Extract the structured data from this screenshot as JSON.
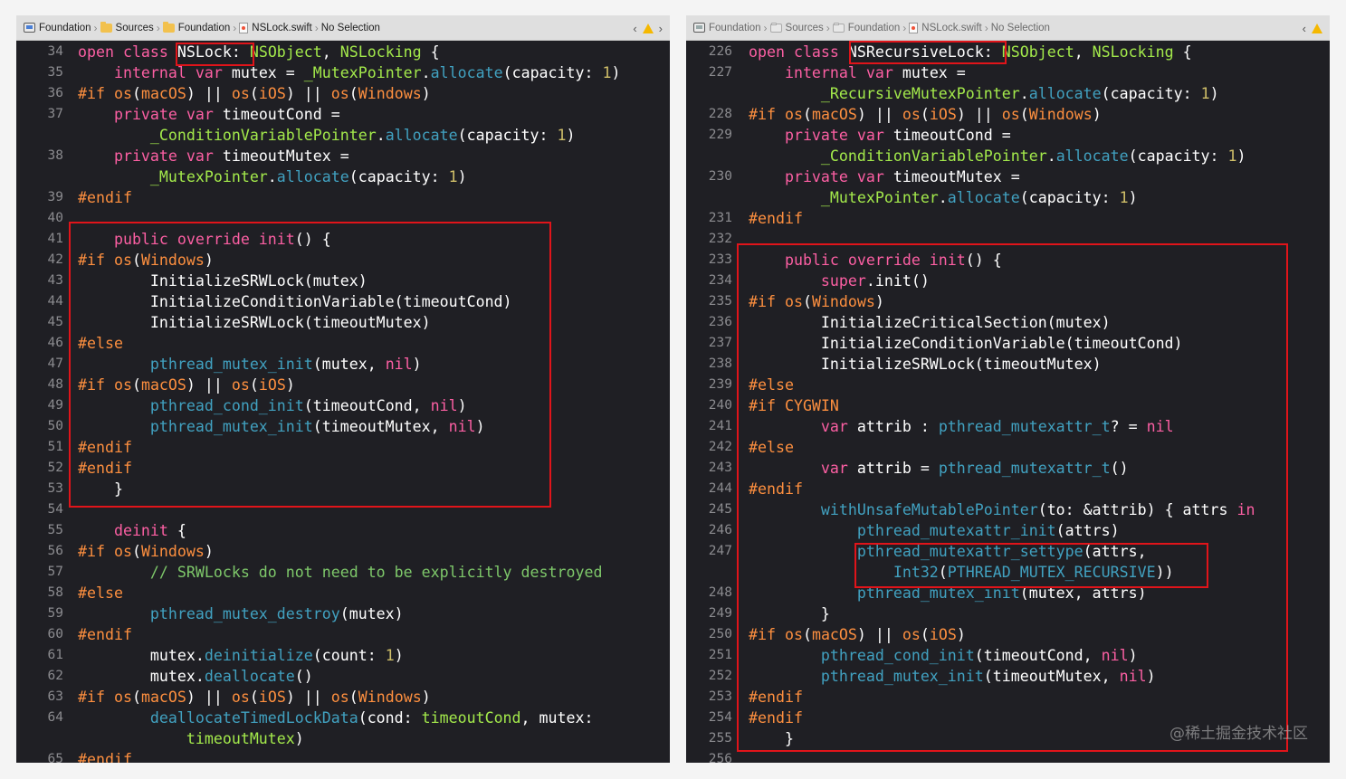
{
  "left_pane": {
    "breadcrumb": [
      "Foundation",
      "Sources",
      "Foundation",
      "NSLock.swift",
      "No Selection"
    ],
    "lines": [
      {
        "n": "34",
        "t": [
          [
            "kw",
            "open class "
          ],
          [
            "pl",
            "NSLock:"
          ],
          [
            "ty",
            " NSObject"
          ],
          [
            "pl",
            ", "
          ],
          [
            "ty",
            "NSLocking"
          ],
          [
            "pl",
            " {"
          ]
        ]
      },
      {
        "n": "35",
        "t": [
          [
            "kw",
            "    internal var "
          ],
          [
            "pl",
            "mutex = "
          ],
          [
            "ty",
            "_MutexPointer"
          ],
          [
            "pl",
            "."
          ],
          [
            "fn",
            "allocate"
          ],
          [
            "pl",
            "(capacity: "
          ],
          [
            "num",
            "1"
          ],
          [
            "pl",
            ")"
          ]
        ]
      },
      {
        "n": "36",
        "t": [
          [
            "pp",
            "#if "
          ],
          [
            "pp",
            "os"
          ],
          [
            "pl",
            "("
          ],
          [
            "pp",
            "macOS"
          ],
          [
            "pl",
            ") || "
          ],
          [
            "pp",
            "os"
          ],
          [
            "pl",
            "("
          ],
          [
            "pp",
            "iOS"
          ],
          [
            "pl",
            ") || "
          ],
          [
            "pp",
            "os"
          ],
          [
            "pl",
            "("
          ],
          [
            "pp",
            "Windows"
          ],
          [
            "pl",
            ")"
          ]
        ]
      },
      {
        "n": "37",
        "t": [
          [
            "kw",
            "    private var "
          ],
          [
            "pl",
            "timeoutCond ="
          ]
        ]
      },
      {
        "n": "",
        "t": [
          [
            "ty",
            "        _ConditionVariablePointer"
          ],
          [
            "pl",
            "."
          ],
          [
            "fn",
            "allocate"
          ],
          [
            "pl",
            "(capacity: "
          ],
          [
            "num",
            "1"
          ],
          [
            "pl",
            ")"
          ]
        ]
      },
      {
        "n": "38",
        "t": [
          [
            "kw",
            "    private var "
          ],
          [
            "pl",
            "timeoutMutex ="
          ]
        ]
      },
      {
        "n": "",
        "t": [
          [
            "ty",
            "        _MutexPointer"
          ],
          [
            "pl",
            "."
          ],
          [
            "fn",
            "allocate"
          ],
          [
            "pl",
            "(capacity: "
          ],
          [
            "num",
            "1"
          ],
          [
            "pl",
            ")"
          ]
        ]
      },
      {
        "n": "39",
        "t": [
          [
            "pp",
            "#endif"
          ]
        ]
      },
      {
        "n": "40",
        "t": []
      },
      {
        "n": "41",
        "t": [
          [
            "kw",
            "    public override init"
          ],
          [
            "pl",
            "() {"
          ]
        ]
      },
      {
        "n": "42",
        "t": [
          [
            "pp",
            "#if "
          ],
          [
            "pp",
            "os"
          ],
          [
            "pl",
            "("
          ],
          [
            "pp",
            "Windows"
          ],
          [
            "pl",
            ")"
          ]
        ]
      },
      {
        "n": "43",
        "t": [
          [
            "pl",
            "        InitializeSRWLock(mutex)"
          ]
        ]
      },
      {
        "n": "44",
        "t": [
          [
            "pl",
            "        InitializeConditionVariable(timeoutCond)"
          ]
        ]
      },
      {
        "n": "45",
        "t": [
          [
            "pl",
            "        InitializeSRWLock(timeoutMutex)"
          ]
        ]
      },
      {
        "n": "46",
        "t": [
          [
            "pp",
            "#else"
          ]
        ]
      },
      {
        "n": "47",
        "t": [
          [
            "fn",
            "        pthread_mutex_init"
          ],
          [
            "pl",
            "("
          ],
          [
            "pl",
            "mutex, "
          ],
          [
            "kw",
            "nil"
          ],
          [
            "pl",
            ")"
          ]
        ]
      },
      {
        "n": "48",
        "t": [
          [
            "pp",
            "#if "
          ],
          [
            "pp",
            "os"
          ],
          [
            "pl",
            "("
          ],
          [
            "pp",
            "macOS"
          ],
          [
            "pl",
            ") || "
          ],
          [
            "pp",
            "os"
          ],
          [
            "pl",
            "("
          ],
          [
            "pp",
            "iOS"
          ],
          [
            "pl",
            ")"
          ]
        ]
      },
      {
        "n": "49",
        "t": [
          [
            "fn",
            "        pthread_cond_init"
          ],
          [
            "pl",
            "("
          ],
          [
            "pl",
            "timeoutCond, "
          ],
          [
            "kw",
            "nil"
          ],
          [
            "pl",
            ")"
          ]
        ]
      },
      {
        "n": "50",
        "t": [
          [
            "fn",
            "        pthread_mutex_init"
          ],
          [
            "pl",
            "("
          ],
          [
            "pl",
            "timeoutMutex, "
          ],
          [
            "kw",
            "nil"
          ],
          [
            "pl",
            ")"
          ]
        ]
      },
      {
        "n": "51",
        "t": [
          [
            "pp",
            "#endif"
          ]
        ]
      },
      {
        "n": "52",
        "t": [
          [
            "pp",
            "#endif"
          ]
        ]
      },
      {
        "n": "53",
        "t": [
          [
            "pl",
            "    }"
          ]
        ]
      },
      {
        "n": "54",
        "t": []
      },
      {
        "n": "55",
        "t": [
          [
            "kw",
            "    deinit"
          ],
          [
            "pl",
            " {"
          ]
        ]
      },
      {
        "n": "56",
        "t": [
          [
            "pp",
            "#if "
          ],
          [
            "pp",
            "os"
          ],
          [
            "pl",
            "("
          ],
          [
            "pp",
            "Windows"
          ],
          [
            "pl",
            ")"
          ]
        ]
      },
      {
        "n": "57",
        "t": [
          [
            "cm",
            "        // SRWLocks do not need to be explicitly destroyed"
          ]
        ]
      },
      {
        "n": "58",
        "t": [
          [
            "pp",
            "#else"
          ]
        ]
      },
      {
        "n": "59",
        "t": [
          [
            "fn",
            "        pthread_mutex_destroy"
          ],
          [
            "pl",
            "(mutex)"
          ]
        ]
      },
      {
        "n": "60",
        "t": [
          [
            "pp",
            "#endif"
          ]
        ]
      },
      {
        "n": "61",
        "t": [
          [
            "pl",
            "        mutex."
          ],
          [
            "fn",
            "deinitialize"
          ],
          [
            "pl",
            "(count: "
          ],
          [
            "num",
            "1"
          ],
          [
            "pl",
            ")"
          ]
        ]
      },
      {
        "n": "62",
        "t": [
          [
            "pl",
            "        mutex."
          ],
          [
            "fn",
            "deallocate"
          ],
          [
            "pl",
            "()"
          ]
        ]
      },
      {
        "n": "63",
        "t": [
          [
            "pp",
            "#if "
          ],
          [
            "pp",
            "os"
          ],
          [
            "pl",
            "("
          ],
          [
            "pp",
            "macOS"
          ],
          [
            "pl",
            ") || "
          ],
          [
            "pp",
            "os"
          ],
          [
            "pl",
            "("
          ],
          [
            "pp",
            "iOS"
          ],
          [
            "pl",
            ") || "
          ],
          [
            "pp",
            "os"
          ],
          [
            "pl",
            "("
          ],
          [
            "pp",
            "Windows"
          ],
          [
            "pl",
            ")"
          ]
        ]
      },
      {
        "n": "64",
        "t": [
          [
            "fn",
            "        deallocateTimedLockData"
          ],
          [
            "pl",
            "(cond: "
          ],
          [
            "ty",
            "timeoutCond"
          ],
          [
            "pl",
            ", mutex:"
          ]
        ]
      },
      {
        "n": "",
        "t": [
          [
            "ty",
            "            timeoutMutex"
          ],
          [
            "pl",
            ")"
          ]
        ]
      },
      {
        "n": "65",
        "t": [
          [
            "pp",
            "#endif"
          ]
        ]
      }
    ]
  },
  "right_pane": {
    "breadcrumb": [
      "Foundation",
      "Sources",
      "Foundation",
      "NSLock.swift",
      "No Selection"
    ],
    "lines": [
      {
        "n": "226",
        "t": [
          [
            "kw",
            "open class "
          ],
          [
            "pl",
            "NSRecursiveLock:"
          ],
          [
            "ty",
            " NSObject"
          ],
          [
            "pl",
            ", "
          ],
          [
            "ty",
            "NSLocking"
          ],
          [
            "pl",
            " {"
          ]
        ]
      },
      {
        "n": "227",
        "t": [
          [
            "kw",
            "    internal var "
          ],
          [
            "pl",
            "mutex ="
          ]
        ]
      },
      {
        "n": "",
        "t": [
          [
            "ty",
            "        _RecursiveMutexPointer"
          ],
          [
            "pl",
            "."
          ],
          [
            "fn",
            "allocate"
          ],
          [
            "pl",
            "(capacity: "
          ],
          [
            "num",
            "1"
          ],
          [
            "pl",
            ")"
          ]
        ]
      },
      {
        "n": "228",
        "t": [
          [
            "pp",
            "#if "
          ],
          [
            "pp",
            "os"
          ],
          [
            "pl",
            "("
          ],
          [
            "pp",
            "macOS"
          ],
          [
            "pl",
            ") || "
          ],
          [
            "pp",
            "os"
          ],
          [
            "pl",
            "("
          ],
          [
            "pp",
            "iOS"
          ],
          [
            "pl",
            ") || "
          ],
          [
            "pp",
            "os"
          ],
          [
            "pl",
            "("
          ],
          [
            "pp",
            "Windows"
          ],
          [
            "pl",
            ")"
          ]
        ]
      },
      {
        "n": "229",
        "t": [
          [
            "kw",
            "    private var "
          ],
          [
            "pl",
            "timeoutCond ="
          ]
        ]
      },
      {
        "n": "",
        "t": [
          [
            "ty",
            "        _ConditionVariablePointer"
          ],
          [
            "pl",
            "."
          ],
          [
            "fn",
            "allocate"
          ],
          [
            "pl",
            "(capacity: "
          ],
          [
            "num",
            "1"
          ],
          [
            "pl",
            ")"
          ]
        ]
      },
      {
        "n": "230",
        "t": [
          [
            "kw",
            "    private var "
          ],
          [
            "pl",
            "timeoutMutex ="
          ]
        ]
      },
      {
        "n": "",
        "t": [
          [
            "ty",
            "        _MutexPointer"
          ],
          [
            "pl",
            "."
          ],
          [
            "fn",
            "allocate"
          ],
          [
            "pl",
            "(capacity: "
          ],
          [
            "num",
            "1"
          ],
          [
            "pl",
            ")"
          ]
        ]
      },
      {
        "n": "231",
        "t": [
          [
            "pp",
            "#endif"
          ]
        ]
      },
      {
        "n": "232",
        "t": []
      },
      {
        "n": "233",
        "t": [
          [
            "kw",
            "    public override init"
          ],
          [
            "pl",
            "() {"
          ]
        ]
      },
      {
        "n": "234",
        "t": [
          [
            "kw",
            "        super"
          ],
          [
            "pl",
            "."
          ],
          [
            "pl",
            "init()"
          ]
        ]
      },
      {
        "n": "235",
        "t": [
          [
            "pp",
            "#if "
          ],
          [
            "pp",
            "os"
          ],
          [
            "pl",
            "("
          ],
          [
            "pp",
            "Windows"
          ],
          [
            "pl",
            ")"
          ]
        ]
      },
      {
        "n": "236",
        "t": [
          [
            "pl",
            "        InitializeCriticalSection(mutex)"
          ]
        ]
      },
      {
        "n": "237",
        "t": [
          [
            "pl",
            "        InitializeConditionVariable(timeoutCond)"
          ]
        ]
      },
      {
        "n": "238",
        "t": [
          [
            "pl",
            "        InitializeSRWLock(timeoutMutex)"
          ]
        ]
      },
      {
        "n": "239",
        "t": [
          [
            "pp",
            "#else"
          ]
        ]
      },
      {
        "n": "240",
        "t": [
          [
            "pp",
            "#if CYGWIN"
          ]
        ]
      },
      {
        "n": "241",
        "t": [
          [
            "kw",
            "        var "
          ],
          [
            "pl",
            "attrib : "
          ],
          [
            "fn",
            "pthread_mutexattr_t"
          ],
          [
            "pl",
            "? = "
          ],
          [
            "kw",
            "nil"
          ]
        ]
      },
      {
        "n": "242",
        "t": [
          [
            "pp",
            "#else"
          ]
        ]
      },
      {
        "n": "243",
        "t": [
          [
            "kw",
            "        var "
          ],
          [
            "pl",
            "attrib = "
          ],
          [
            "fn",
            "pthread_mutexattr_t"
          ],
          [
            "pl",
            "()"
          ]
        ]
      },
      {
        "n": "244",
        "t": [
          [
            "pp",
            "#endif"
          ]
        ]
      },
      {
        "n": "245",
        "t": [
          [
            "fn",
            "        withUnsafeMutablePointer"
          ],
          [
            "pl",
            "(to: &attrib) { attrs "
          ],
          [
            "kw",
            "in"
          ]
        ]
      },
      {
        "n": "246",
        "t": [
          [
            "fn",
            "            pthread_mutexattr_init"
          ],
          [
            "pl",
            "(attrs)"
          ]
        ]
      },
      {
        "n": "247",
        "t": [
          [
            "fn",
            "            pthread_mutexattr_settype"
          ],
          [
            "pl",
            "(attrs,"
          ]
        ]
      },
      {
        "n": "",
        "t": [
          [
            "fn",
            "                Int32"
          ],
          [
            "pl",
            "("
          ],
          [
            "fn",
            "PTHREAD_MUTEX_RECURSIVE"
          ],
          [
            "pl",
            "))"
          ]
        ]
      },
      {
        "n": "248",
        "t": [
          [
            "fn",
            "            pthread_mutex_init"
          ],
          [
            "pl",
            "(mutex, attrs)"
          ]
        ]
      },
      {
        "n": "249",
        "t": [
          [
            "pl",
            "        }"
          ]
        ]
      },
      {
        "n": "250",
        "t": [
          [
            "pp",
            "#if "
          ],
          [
            "pp",
            "os"
          ],
          [
            "pl",
            "("
          ],
          [
            "pp",
            "macOS"
          ],
          [
            "pl",
            ") || "
          ],
          [
            "pp",
            "os"
          ],
          [
            "pl",
            "("
          ],
          [
            "pp",
            "iOS"
          ],
          [
            "pl",
            ")"
          ]
        ]
      },
      {
        "n": "251",
        "t": [
          [
            "fn",
            "        pthread_cond_init"
          ],
          [
            "pl",
            "(timeoutCond, "
          ],
          [
            "kw",
            "nil"
          ],
          [
            "pl",
            ")"
          ]
        ]
      },
      {
        "n": "252",
        "t": [
          [
            "fn",
            "        pthread_mutex_init"
          ],
          [
            "pl",
            "(timeoutMutex, "
          ],
          [
            "kw",
            "nil"
          ],
          [
            "pl",
            ")"
          ]
        ]
      },
      {
        "n": "253",
        "t": [
          [
            "pp",
            "#endif"
          ]
        ]
      },
      {
        "n": "254",
        "t": [
          [
            "pp",
            "#endif"
          ]
        ]
      },
      {
        "n": "255",
        "t": [
          [
            "pl",
            "    }"
          ]
        ]
      },
      {
        "n": "256",
        "t": []
      }
    ]
  },
  "watermark": "@稀土掘金技术社区",
  "colors": {
    "highlight_box": "#e0141a",
    "editor_bg": "#1f1f24",
    "keyword": "#fc5fa3",
    "type": "#a3e94b",
    "function": "#41a1c0",
    "preprocessor": "#fd8f3f",
    "number": "#d0bf69",
    "comment": "#7ec86a"
  }
}
